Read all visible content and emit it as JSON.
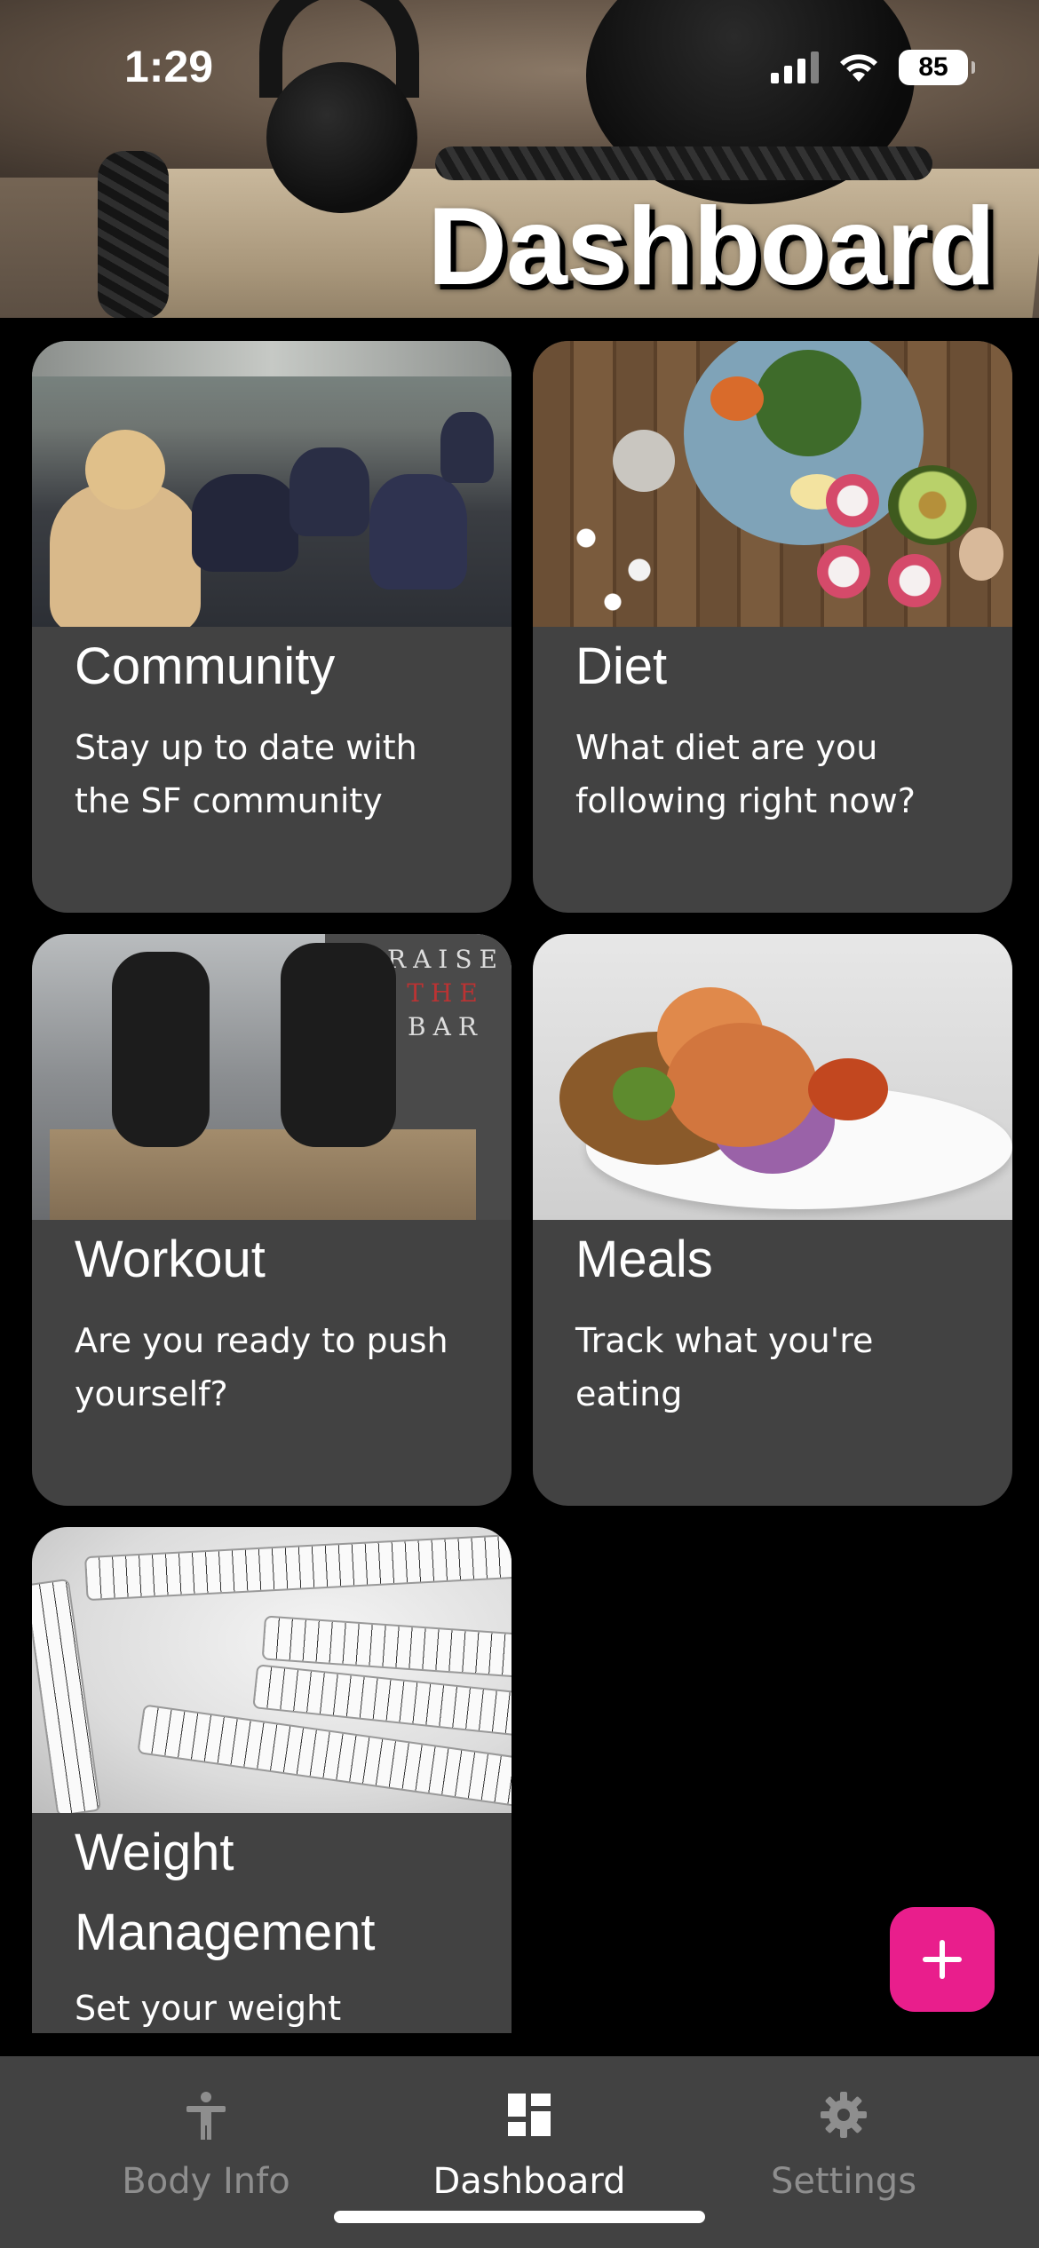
{
  "status_bar": {
    "time": "1:29",
    "battery": "85",
    "icons": [
      "cellular-signal-icon",
      "wifi-icon",
      "battery-icon"
    ]
  },
  "header": {
    "title": "Dashboard"
  },
  "cards": [
    {
      "title": "Community",
      "description": "Stay up to date with the SF community",
      "image": "group-exercise-class-photo"
    },
    {
      "title": "Diet",
      "description": "What diet are you following right now?",
      "image": "healthy-food-plate-photo"
    },
    {
      "title": "Workout",
      "description": "Are you ready to push yourself?",
      "image": "box-jump-gym-photo",
      "photo_text": [
        "RAISE",
        "THE",
        "BAR"
      ]
    },
    {
      "title": "Meals",
      "description": "Track what you're eating",
      "image": "shrimp-stir-fry-photo"
    },
    {
      "title": "Weight Management",
      "description": "Set your weight",
      "image": "measuring-tape-photo"
    }
  ],
  "fab": {
    "icon": "plus-icon",
    "color": "#e91e8c"
  },
  "bottom_nav": {
    "items": [
      {
        "label": "Body Info",
        "icon": "person-icon",
        "active": false
      },
      {
        "label": "Dashboard",
        "icon": "dashboard-icon",
        "active": true
      },
      {
        "label": "Settings",
        "icon": "gear-icon",
        "active": false
      }
    ]
  },
  "colors": {
    "background": "#000000",
    "card": "#424242",
    "nav_bar": "#424242",
    "accent": "#e91e8c",
    "inactive_label": "#8e8e8e"
  }
}
